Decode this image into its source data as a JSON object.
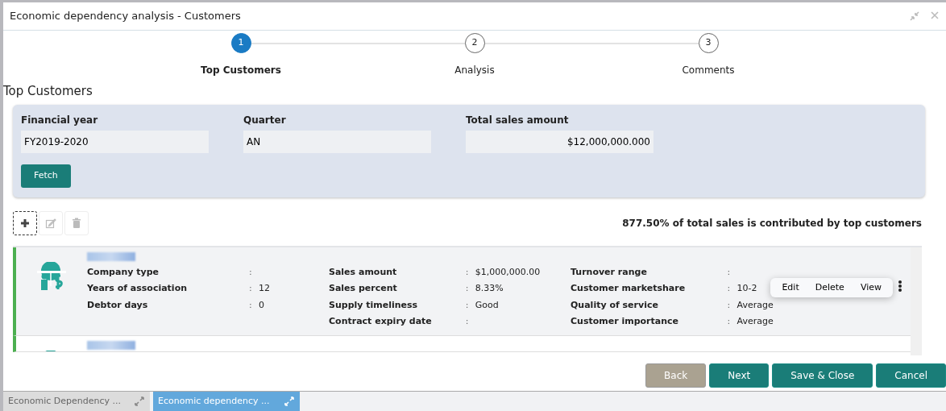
{
  "window": {
    "title": "Economic dependency analysis - Customers"
  },
  "steps": [
    {
      "number": "1",
      "label": "Top Customers",
      "selected": true
    },
    {
      "number": "2",
      "label": "Analysis",
      "selected": false
    },
    {
      "number": "3",
      "label": "Comments",
      "selected": false
    }
  ],
  "section_title": "Top Customers",
  "filters": {
    "fields": [
      {
        "label": "Financial year",
        "value": "FY2019-2020",
        "kind": "text"
      },
      {
        "label": "Quarter",
        "value": "AN",
        "kind": "text"
      },
      {
        "label": "Total sales amount",
        "value": "$12,000,000.000",
        "kind": "amount"
      }
    ],
    "button": "Fetch"
  },
  "toolbar": [
    {
      "kind": "add",
      "disabled": false,
      "focused": true
    },
    {
      "kind": "edit",
      "disabled": true,
      "focused": false
    },
    {
      "kind": "delete",
      "disabled": true,
      "focused": false
    }
  ],
  "summary": "877.50% of total sales is contributed by top customers",
  "customers": [
    {
      "cut_off": false,
      "columns": [
        [
          {
            "label": "Company type",
            "sep": ":"
          },
          {
            "label": "Years of association",
            "sep": ":",
            "value": "12"
          },
          {
            "label": "Debtor days",
            "sep": ":",
            "value": "0"
          }
        ],
        [
          {
            "label": "Sales amount",
            "sep": ":",
            "value": "$1,000,000.00"
          },
          {
            "label": "Sales percent",
            "sep": ":",
            "value": "8.33%"
          },
          {
            "label": "Supply timeliness",
            "sep": ":",
            "value": "Good"
          },
          {
            "label": "Contract expiry date",
            "sep": ":"
          }
        ],
        [
          {
            "label": "Turnover range",
            "sep": ":"
          },
          {
            "label": "Customer marketshare",
            "sep": ":",
            "value": "10-2"
          },
          {
            "label": "Quality of service",
            "sep": ":",
            "value": "Average"
          },
          {
            "label": "Customer importance",
            "sep": ":",
            "value": "Average"
          }
        ]
      ]
    },
    {
      "cut_off": true
    }
  ],
  "row_menu": {
    "open": true,
    "items": [
      "Edit",
      "Delete",
      "View"
    ]
  },
  "footer_buttons": [
    {
      "label": "Back",
      "disabled": true
    },
    {
      "label": "Next",
      "disabled": false
    },
    {
      "label": "Save & Close",
      "disabled": false
    },
    {
      "label": "Cancel",
      "disabled": false
    }
  ],
  "taskbar": [
    {
      "label": "Economic Dependency ...",
      "selected": false
    },
    {
      "label": "Economic dependency ...",
      "selected": true
    }
  ]
}
